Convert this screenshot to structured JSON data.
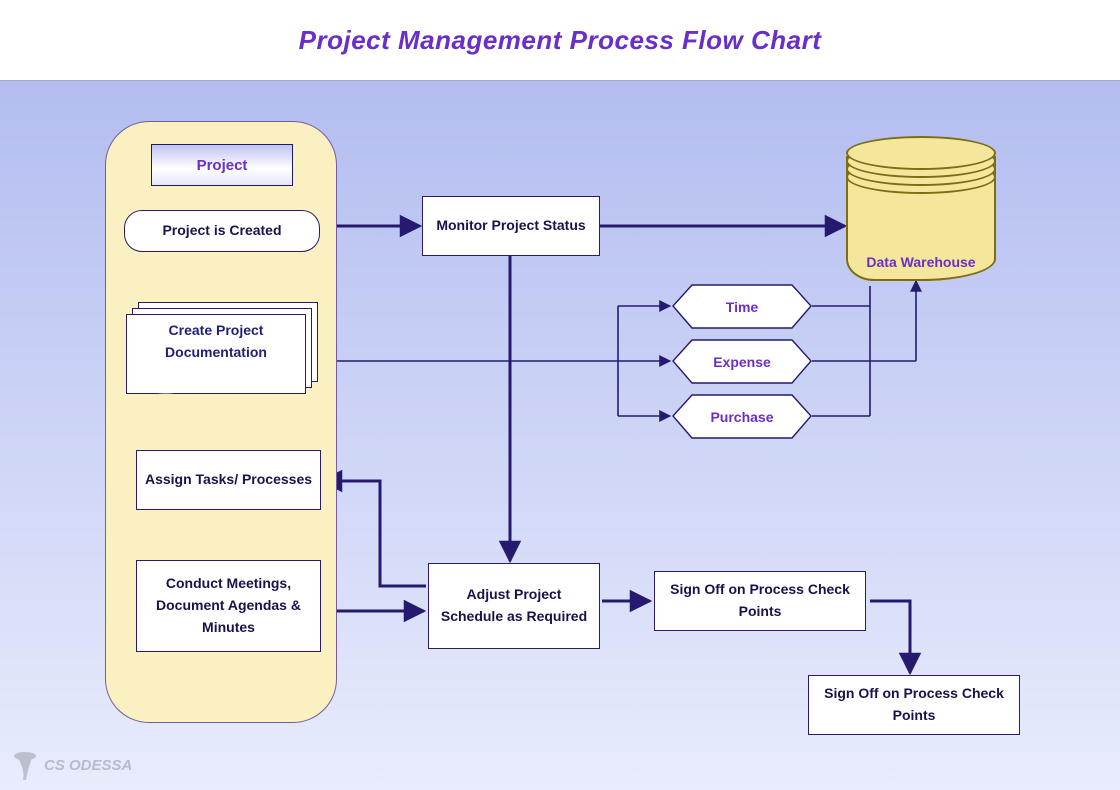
{
  "title": "Project Management Process Flow Chart",
  "watermark": "CS ODESSA",
  "container": {
    "header": "Project"
  },
  "nodes": {
    "create": "Project is Created",
    "doc": "Create Project Documentation",
    "assign": "Assign Tasks/ Processes",
    "meetings": "Conduct Meetings, Document Agendas & Minutes",
    "monitor": "Monitor Project Status",
    "adjust": "Adjust Project Schedule as Required",
    "signoff1": "Sign Off on Process Check Points",
    "signoff2": "Sign Off on Process Check Points",
    "time": "Time",
    "expense": "Expense",
    "purchase": "Purchase",
    "datawarehouse": "Data Warehouse"
  }
}
